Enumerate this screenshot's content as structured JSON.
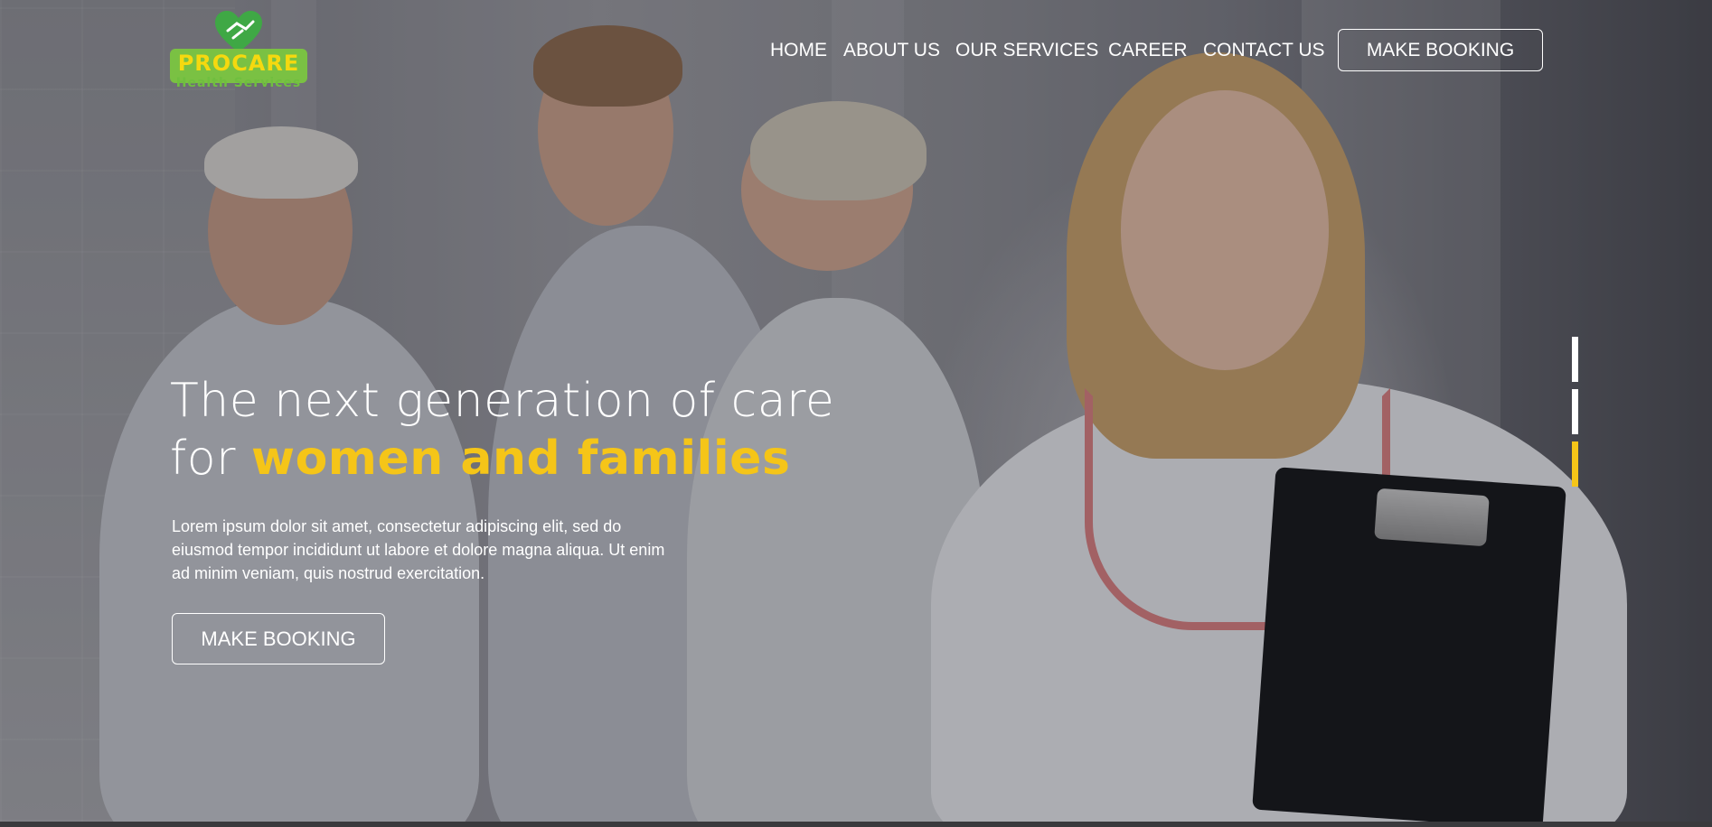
{
  "brand": {
    "name": "PROCARE",
    "tagline": "Health Services",
    "colors": {
      "green": "#7ac143",
      "yellow": "#f5d90f"
    }
  },
  "nav": {
    "items": [
      {
        "label": "HOME"
      },
      {
        "label": "ABOUT US"
      },
      {
        "label": "OUR SERVICES"
      },
      {
        "label": "CAREER"
      },
      {
        "label": "CONTACT US"
      }
    ],
    "cta_label": "MAKE BOOKING"
  },
  "hero": {
    "headline_line1": "The next generation of care",
    "headline_line2_prefix": "for ",
    "headline_highlight": "women and families",
    "body": "Lorem ipsum dolor sit amet, consectetur adipiscing elit, sed do eiusmod tempor incididunt ut labore et dolore magna aliqua. Ut enim ad minim veniam, quis nostrud exercitation.",
    "cta_label": "MAKE BOOKING",
    "accent_color": "#f5c518"
  },
  "slider": {
    "slides": 3,
    "active_index": 3
  }
}
